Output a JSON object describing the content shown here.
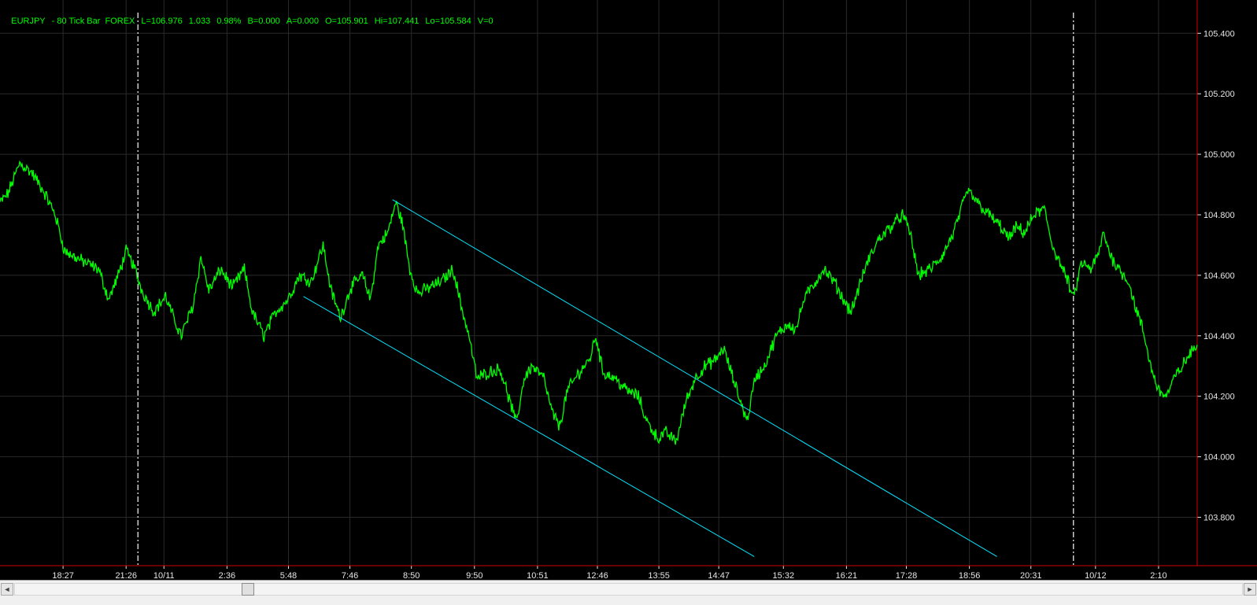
{
  "header": {
    "symbol": "EURJPY",
    "label": "- 80 Tick Bar  FOREX",
    "last": "L=106.976",
    "change": "1.033",
    "change_pct": "0.98%",
    "bid": "B=0.000",
    "ask": "A=0.000",
    "open": "O=105.901",
    "high": "Hi=107.441",
    "low": "Lo=105.584",
    "volume": "V=0"
  },
  "colors": {
    "background": "#000000",
    "price_line": "#00ff00",
    "channel_line": "#00e5ff",
    "axis_line": "#d00000",
    "grid": "#2a2a2a",
    "axis_text": "#e6e6e6",
    "session_divider": "#ffffff"
  },
  "chart_data": {
    "type": "line",
    "grid": true,
    "ylim": [
      103.64,
      105.51
    ],
    "y_ticks": [
      "105.400",
      "105.200",
      "105.000",
      "104.800",
      "104.600",
      "104.400",
      "104.200",
      "104.000",
      "103.800"
    ],
    "y_tick_values": [
      105.4,
      105.2,
      105.0,
      104.8,
      104.6,
      104.4,
      104.2,
      104.0,
      103.8
    ],
    "x_ticks": [
      "18:27",
      "21:26",
      "10/11",
      "2:36",
      "5:48",
      "7:46",
      "8:50",
      "9:50",
      "10:51",
      "12:46",
      "13:55",
      "14:47",
      "15:32",
      "16:21",
      "17:28",
      "18:56",
      "20:31",
      "10/12",
      "2:10"
    ],
    "x_tick_index": [
      80,
      160,
      208,
      288,
      366,
      444,
      522,
      602,
      682,
      758,
      836,
      912,
      994,
      1074,
      1150,
      1230,
      1308,
      1390,
      1470
    ],
    "session_dividers": [
      175,
      1362
    ],
    "n_bars": 1520,
    "series": [
      {
        "points": [
          [
            0,
            104.84
          ],
          [
            10,
            104.87
          ],
          [
            25,
            104.97
          ],
          [
            40,
            104.94
          ],
          [
            55,
            104.88
          ],
          [
            70,
            104.8
          ],
          [
            82,
            104.68
          ],
          [
            95,
            104.66
          ],
          [
            110,
            104.64
          ],
          [
            125,
            104.62
          ],
          [
            138,
            104.52
          ],
          [
            150,
            104.6
          ],
          [
            160,
            104.68
          ],
          [
            170,
            104.63
          ],
          [
            180,
            104.55
          ],
          [
            195,
            104.48
          ],
          [
            210,
            104.53
          ],
          [
            220,
            104.46
          ],
          [
            230,
            104.4
          ],
          [
            245,
            104.5
          ],
          [
            255,
            104.66
          ],
          [
            265,
            104.55
          ],
          [
            280,
            104.62
          ],
          [
            295,
            104.56
          ],
          [
            310,
            104.62
          ],
          [
            320,
            104.48
          ],
          [
            335,
            104.4
          ],
          [
            350,
            104.48
          ],
          [
            365,
            104.52
          ],
          [
            380,
            104.6
          ],
          [
            395,
            104.58
          ],
          [
            410,
            104.7
          ],
          [
            420,
            104.55
          ],
          [
            432,
            104.46
          ],
          [
            445,
            104.56
          ],
          [
            460,
            104.6
          ],
          [
            470,
            104.52
          ],
          [
            480,
            104.7
          ],
          [
            492,
            104.74
          ],
          [
            502,
            104.84
          ],
          [
            510,
            104.78
          ],
          [
            520,
            104.62
          ],
          [
            530,
            104.54
          ],
          [
            545,
            104.56
          ],
          [
            560,
            104.58
          ],
          [
            575,
            104.62
          ],
          [
            585,
            104.5
          ],
          [
            595,
            104.4
          ],
          [
            605,
            104.26
          ],
          [
            620,
            104.28
          ],
          [
            635,
            104.29
          ],
          [
            645,
            104.2
          ],
          [
            655,
            104.11
          ],
          [
            665,
            104.26
          ],
          [
            675,
            104.3
          ],
          [
            690,
            104.26
          ],
          [
            700,
            104.15
          ],
          [
            710,
            104.1
          ],
          [
            720,
            104.22
          ],
          [
            735,
            104.28
          ],
          [
            748,
            104.32
          ],
          [
            756,
            104.4
          ],
          [
            765,
            104.28
          ],
          [
            780,
            104.26
          ],
          [
            795,
            104.22
          ],
          [
            810,
            104.2
          ],
          [
            820,
            104.12
          ],
          [
            835,
            104.06
          ],
          [
            845,
            104.08
          ],
          [
            858,
            104.05
          ],
          [
            870,
            104.18
          ],
          [
            882,
            104.26
          ],
          [
            895,
            104.3
          ],
          [
            908,
            104.32
          ],
          [
            918,
            104.36
          ],
          [
            930,
            104.26
          ],
          [
            940,
            104.18
          ],
          [
            948,
            104.12
          ],
          [
            958,
            104.26
          ],
          [
            970,
            104.3
          ],
          [
            985,
            104.4
          ],
          [
            1000,
            104.44
          ],
          [
            1010,
            104.42
          ],
          [
            1020,
            104.52
          ],
          [
            1030,
            104.56
          ],
          [
            1045,
            104.62
          ],
          [
            1058,
            104.58
          ],
          [
            1070,
            104.52
          ],
          [
            1080,
            104.48
          ],
          [
            1090,
            104.56
          ],
          [
            1100,
            104.64
          ],
          [
            1115,
            104.72
          ],
          [
            1130,
            104.76
          ],
          [
            1145,
            104.8
          ],
          [
            1155,
            104.74
          ],
          [
            1165,
            104.6
          ],
          [
            1180,
            104.62
          ],
          [
            1195,
            104.66
          ],
          [
            1210,
            104.74
          ],
          [
            1220,
            104.82
          ],
          [
            1228,
            104.88
          ],
          [
            1240,
            104.84
          ],
          [
            1255,
            104.8
          ],
          [
            1270,
            104.76
          ],
          [
            1280,
            104.72
          ],
          [
            1290,
            104.76
          ],
          [
            1300,
            104.74
          ],
          [
            1312,
            104.8
          ],
          [
            1325,
            104.82
          ],
          [
            1335,
            104.7
          ],
          [
            1345,
            104.64
          ],
          [
            1355,
            104.58
          ],
          [
            1362,
            104.52
          ],
          [
            1372,
            104.64
          ],
          [
            1385,
            104.62
          ],
          [
            1395,
            104.68
          ],
          [
            1400,
            104.74
          ],
          [
            1410,
            104.66
          ],
          [
            1420,
            104.62
          ],
          [
            1432,
            104.58
          ],
          [
            1440,
            104.5
          ],
          [
            1450,
            104.42
          ],
          [
            1460,
            104.3
          ],
          [
            1470,
            104.22
          ],
          [
            1480,
            104.2
          ],
          [
            1490,
            104.26
          ],
          [
            1500,
            104.3
          ],
          [
            1510,
            104.34
          ],
          [
            1519,
            104.37
          ]
        ]
      }
    ],
    "channel_lines": [
      {
        "start": [
          385,
          104.53
        ],
        "end": [
          957,
          103.67
        ]
      },
      {
        "start": [
          498,
          104.85
        ],
        "end": [
          1265,
          103.67
        ]
      }
    ]
  },
  "scrollbar": {
    "left_arrow": "◄",
    "right_arrow": "►"
  }
}
